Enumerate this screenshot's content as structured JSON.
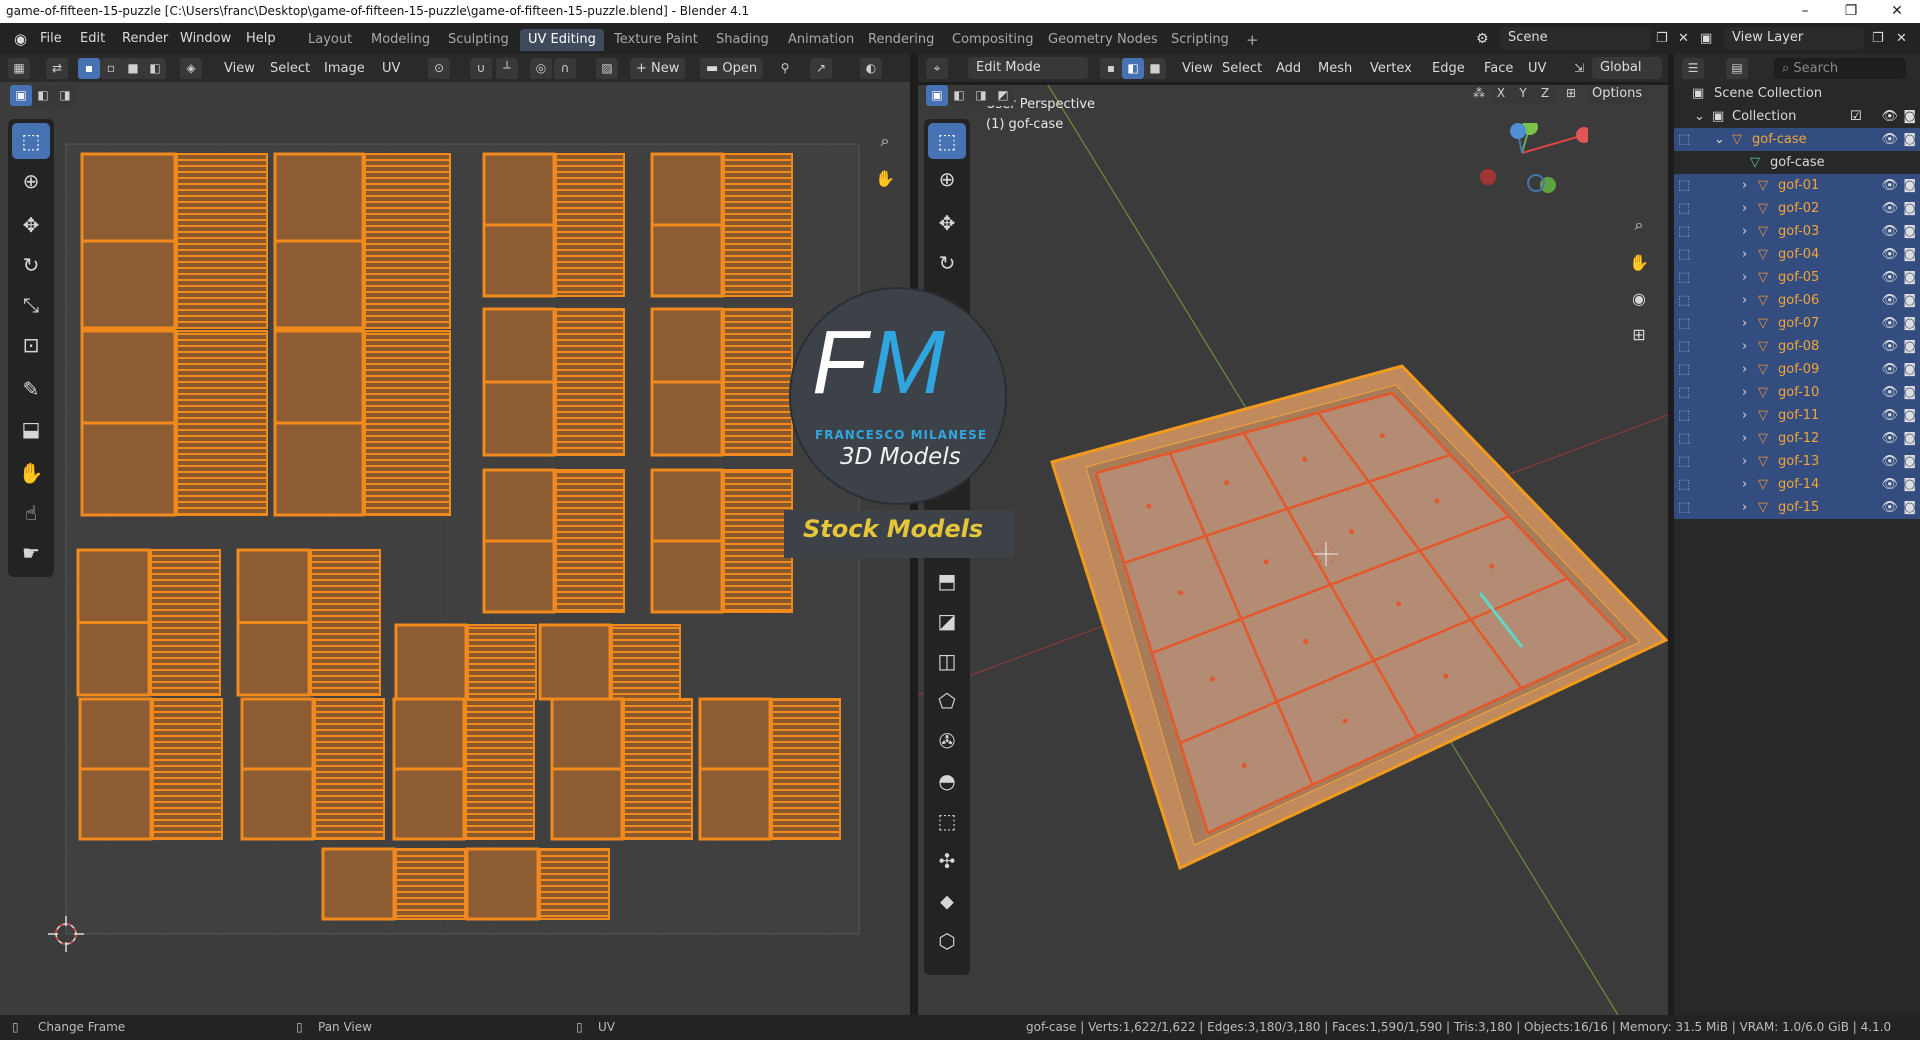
{
  "window": {
    "title": "game-of-fifteen-15-puzzle [C:\\Users\\franc\\Desktop\\game-of-fifteen-15-puzzle\\game-of-fifteen-15-puzzle.blend] - Blender 4.1",
    "minimize": "–",
    "maximize": "❐",
    "close": "✕"
  },
  "menu": [
    "File",
    "Edit",
    "Render",
    "Window",
    "Help"
  ],
  "workspaces": [
    "Layout",
    "Modeling",
    "Sculpting",
    "UV Editing",
    "Texture Paint",
    "Shading",
    "Animation",
    "Rendering",
    "Compositing",
    "Geometry Nodes",
    "Scripting",
    "+"
  ],
  "active_workspace": "UV Editing",
  "scene": {
    "label": "Scene",
    "view_layer": "View Layer"
  },
  "uv_header": {
    "menus": [
      "View",
      "Select",
      "Image",
      "UV"
    ],
    "new_label": "New",
    "open_label": "Open"
  },
  "vp_header": {
    "mode": "Edit Mode",
    "menus": [
      "View",
      "Select",
      "Add",
      "Mesh",
      "Vertex",
      "Edge",
      "Face",
      "UV"
    ],
    "orientation": "Global",
    "options": "Options",
    "axes": [
      "X",
      "Y",
      "Z"
    ]
  },
  "viewport_overlay": {
    "perspective": "User Perspective",
    "object": "(1) gof-case"
  },
  "logo": {
    "initials_f": "F",
    "initials_m": "M",
    "name": "FRANCESCO MILANESE",
    "sub": "3D Models",
    "banner": "Stock Models"
  },
  "outliner": {
    "search_placeholder": "Search",
    "scene_collection": "Scene Collection",
    "collection": "Collection",
    "active_object": "gof-case",
    "active_mesh": "gof-case",
    "objects": [
      "gof-01",
      "gof-02",
      "gof-03",
      "gof-04",
      "gof-05",
      "gof-06",
      "gof-07",
      "gof-08",
      "gof-09",
      "gof-10",
      "gof-11",
      "gof-12",
      "gof-13",
      "gof-14",
      "gof-15"
    ]
  },
  "status": {
    "change_frame": "Change Frame",
    "pan_view": "Pan View",
    "uv": "UV",
    "stats": "gof-case | Verts:1,622/1,622 | Edges:3,180/3,180 | Faces:1,590/1,590 | Tris:3,180 | Objects:16/16 | Memory: 31.5 MiB | VRAM: 1.0/6.0 GiB | 4.1.0"
  },
  "colors": {
    "accent": "#4772b3",
    "uv_orange": "#f08a1c",
    "selection_blue": "#334d80",
    "logo_blue": "#2fa6df"
  }
}
